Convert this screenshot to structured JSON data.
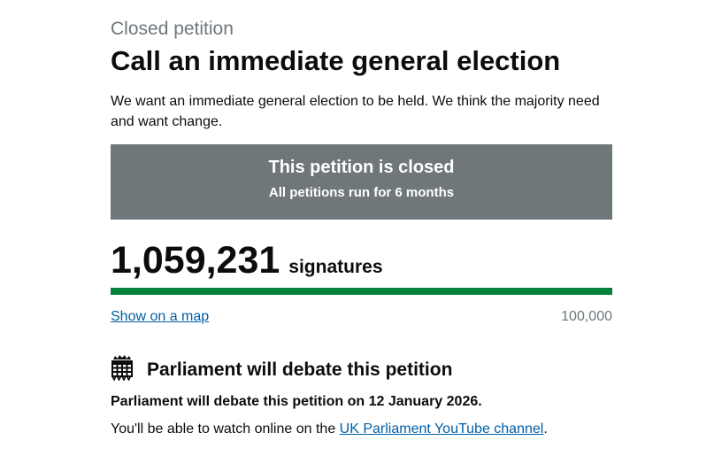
{
  "petition": {
    "status_caption": "Closed petition",
    "title": "Call an immediate general election",
    "action": "We want an immediate general election to be held. We think the majority need and want change."
  },
  "closed_banner": {
    "heading": "This petition is closed",
    "subheading": "All petitions run for 6 months"
  },
  "signatures": {
    "count": "1,059,231",
    "label": "signatures",
    "progress_fraction": 1.0,
    "progress_color": "#00823b",
    "threshold": "100,000"
  },
  "map_link": {
    "label": "Show on a map"
  },
  "debate": {
    "icon": "portcullis-icon",
    "heading": "Parliament will debate this petition",
    "date_text": "Parliament will debate this petition on 12 January 2026.",
    "watch_prefix": "You'll be able to watch online on the ",
    "watch_link": "UK Parliament YouTube channel",
    "watch_suffix": "."
  },
  "colors": {
    "banner_bg": "#6f777b",
    "link": "#005ea5",
    "muted": "#6f777b"
  }
}
